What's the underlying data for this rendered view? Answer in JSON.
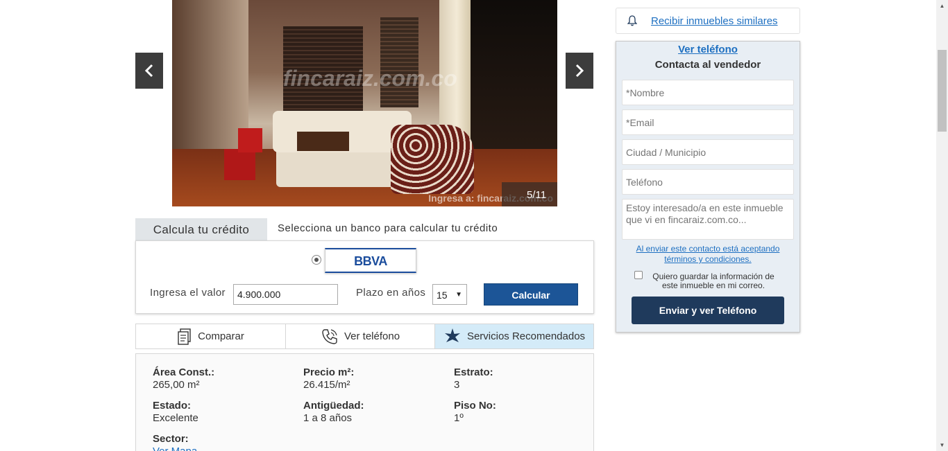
{
  "gallery": {
    "counter": "5/11",
    "watermark": "fincaraiz.com.co",
    "watermark_small": "Ingresa a: fincaraiz.com.co"
  },
  "credit": {
    "tab_label": "Calcula tu crédito",
    "hint": "Selecciona un banco para calcular tu crédito",
    "bank_name": "BBVA",
    "valor_label": "Ingresa el valor",
    "valor_value": "4.900.000",
    "plazo_label": "Plazo en años",
    "plazo_value": "15",
    "calc_button": "Calcular"
  },
  "actions": {
    "compare": "Comparar",
    "phone": "Ver teléfono",
    "services": "Servicios Recomendados"
  },
  "details": {
    "area_key": "Área Const.:",
    "area_val": "265,00 m²",
    "price_key": "Precio m²:",
    "price_val": "26.415/m²",
    "estrato_key": "Estrato:",
    "estrato_val": "3",
    "estado_key": "Estado:",
    "estado_val": "Excelente",
    "antiguedad_key": "Antigüedad:",
    "antiguedad_val": "1 a 8 años",
    "piso_key": "Piso No:",
    "piso_val": "1º",
    "sector_key": "Sector:",
    "sector_val": "Ver Mapa"
  },
  "alert": {
    "link": "Recibir inmuebles similares"
  },
  "contact": {
    "ver_telefono": "Ver teléfono",
    "title": "Contacta al vendedor",
    "name_ph": "*Nombre",
    "email_ph": "*Email",
    "city_ph": "Ciudad / Municipio",
    "phone_ph": "Teléfono",
    "message_ph": "Estoy interesado/a en este inmueble que vi en fincaraiz.com.co...",
    "terms": "Al enviar este contacto está aceptando términos y condiciones.",
    "save_info": "Quiero guardar la información de este inmueble en mi correo.",
    "send_button": "Enviar y ver Teléfono"
  },
  "colors": {
    "primary_button": "#1c5597",
    "send_button": "#1f3a5c",
    "link": "#1d6fc1",
    "services_highlight": "#d4ebf8",
    "contact_bg": "#e8eef4"
  }
}
